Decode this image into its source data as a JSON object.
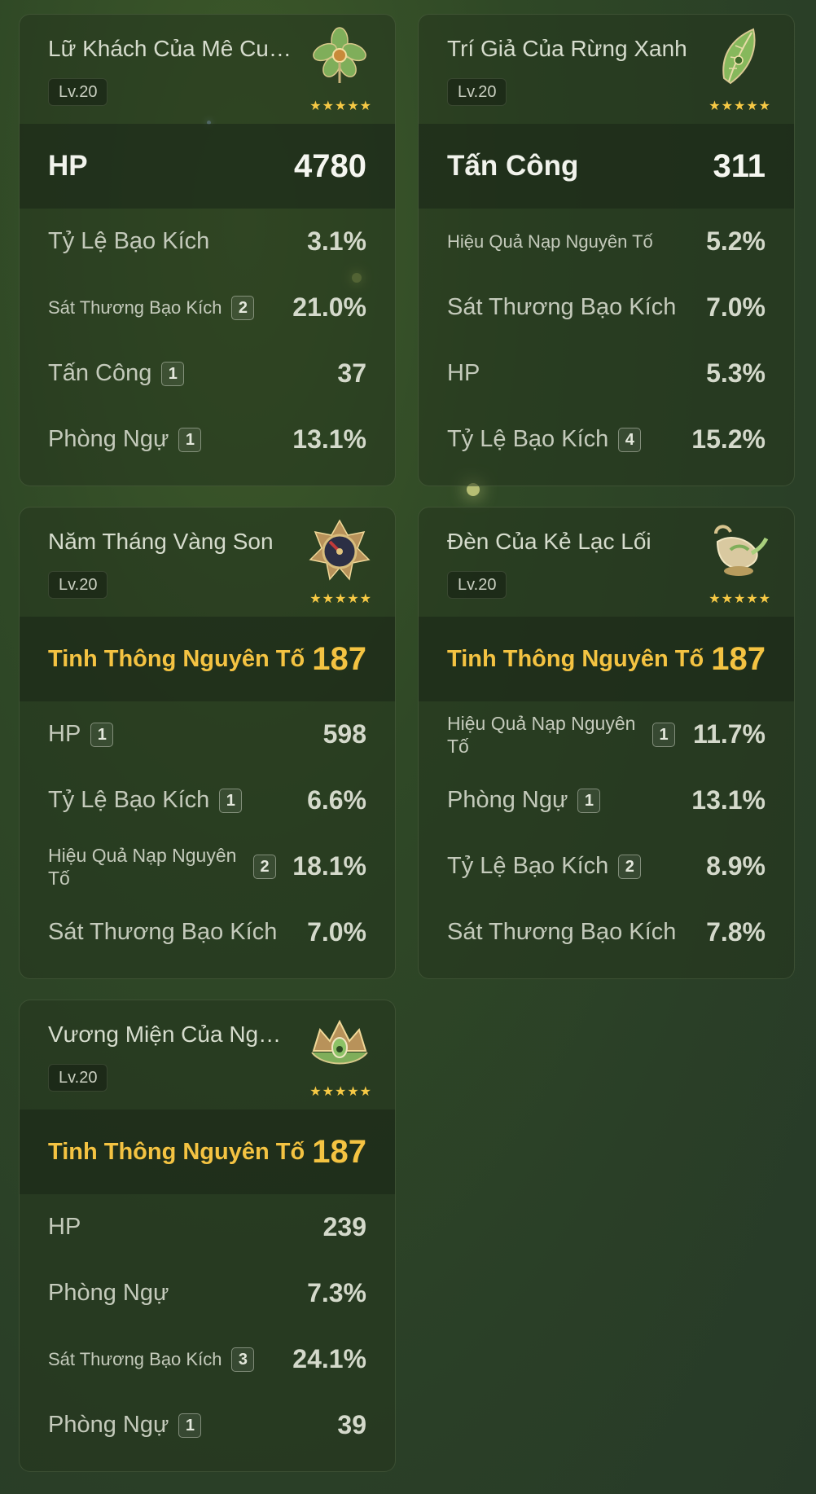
{
  "artifacts": [
    {
      "name": "Lữ Khách Của Mê Cung",
      "level": "Lv.20",
      "stars": "★★★★★",
      "icon": "flower-icon",
      "main_stat": {
        "label": "HP",
        "value": "4780",
        "highlight": false
      },
      "substats": [
        {
          "label": "Tỷ Lệ Bạo Kích",
          "value": "3.1%",
          "badge": ""
        },
        {
          "label": "Sát Thương Bạo Kích",
          "value": "21.0%",
          "badge": "2"
        },
        {
          "label": "Tấn Công",
          "value": "37",
          "badge": "1"
        },
        {
          "label": "Phòng Ngự",
          "value": "13.1%",
          "badge": "1"
        }
      ]
    },
    {
      "name": "Trí Giả Của Rừng Xanh",
      "level": "Lv.20",
      "stars": "★★★★★",
      "icon": "feather-icon",
      "main_stat": {
        "label": "Tấn Công",
        "value": "311",
        "highlight": false
      },
      "substats": [
        {
          "label": "Hiệu Quả Nạp Nguyên Tố",
          "value": "5.2%",
          "badge": ""
        },
        {
          "label": "Sát Thương Bạo Kích",
          "value": "7.0%",
          "badge": ""
        },
        {
          "label": "HP",
          "value": "5.3%",
          "badge": ""
        },
        {
          "label": "Tỷ Lệ Bạo Kích",
          "value": "15.2%",
          "badge": "4"
        }
      ]
    },
    {
      "name": "Năm Tháng Vàng Son",
      "level": "Lv.20",
      "stars": "★★★★★",
      "icon": "sundial-icon",
      "main_stat": {
        "label": "Tinh Thông Nguyên Tố",
        "value": "187",
        "highlight": true
      },
      "substats": [
        {
          "label": "HP",
          "value": "598",
          "badge": "1"
        },
        {
          "label": "Tỷ Lệ Bạo Kích",
          "value": "6.6%",
          "badge": "1"
        },
        {
          "label": "Hiệu Quả Nạp Nguyên Tố",
          "value": "18.1%",
          "badge": "2"
        },
        {
          "label": "Sát Thương Bạo Kích",
          "value": "7.0%",
          "badge": ""
        }
      ]
    },
    {
      "name": "Đèn Của Kẻ Lạc Lối",
      "level": "Lv.20",
      "stars": "★★★★★",
      "icon": "lamp-icon",
      "main_stat": {
        "label": "Tinh Thông Nguyên Tố",
        "value": "187",
        "highlight": true
      },
      "substats": [
        {
          "label": "Hiệu Quả Nạp Nguyên Tố",
          "value": "11.7%",
          "badge": "1"
        },
        {
          "label": "Phòng Ngự",
          "value": "13.1%",
          "badge": "1"
        },
        {
          "label": "Tỷ Lệ Bạo Kích",
          "value": "8.9%",
          "badge": "2"
        },
        {
          "label": "Sát Thương Bạo Kích",
          "value": "7.8%",
          "badge": ""
        }
      ]
    },
    {
      "name": "Vương Miện Của Nguy...",
      "level": "Lv.20",
      "stars": "★★★★★",
      "icon": "crown-icon",
      "main_stat": {
        "label": "Tinh Thông Nguyên Tố",
        "value": "187",
        "highlight": true
      },
      "substats": [
        {
          "label": "HP",
          "value": "239",
          "badge": ""
        },
        {
          "label": "Phòng Ngự",
          "value": "7.3%",
          "badge": ""
        },
        {
          "label": "Sát Thương Bạo Kích",
          "value": "24.1%",
          "badge": "3"
        },
        {
          "label": "Phòng Ngự",
          "value": "39",
          "badge": "1"
        }
      ]
    }
  ]
}
